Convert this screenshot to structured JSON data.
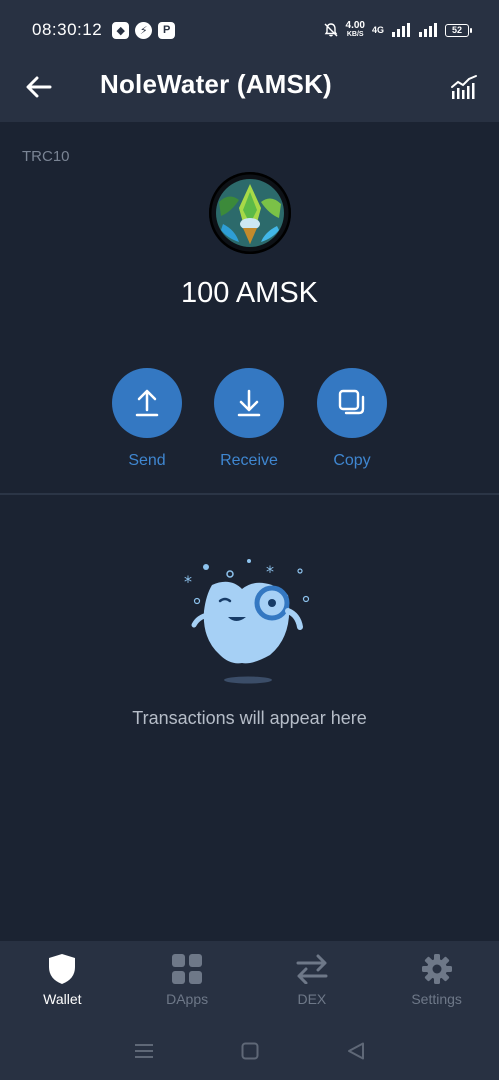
{
  "status_bar": {
    "time": "08:30:12",
    "net_speed_value": "4.00",
    "net_speed_unit": "KB/S",
    "network_type": "4G",
    "battery": "52"
  },
  "header": {
    "title": "NoleWater (AMSK)"
  },
  "token": {
    "type": "TRC10",
    "balance": "100 AMSK"
  },
  "actions": {
    "send": "Send",
    "receive": "Receive",
    "copy": "Copy"
  },
  "empty_state": {
    "message": "Transactions will appear here"
  },
  "bottom_nav": {
    "items": [
      {
        "label": "Wallet",
        "icon": "shield-icon",
        "active": true
      },
      {
        "label": "DApps",
        "icon": "grid-icon",
        "active": false
      },
      {
        "label": "DEX",
        "icon": "swap-arrows-icon",
        "active": false
      },
      {
        "label": "Settings",
        "icon": "gear-icon",
        "active": false
      }
    ]
  },
  "colors": {
    "background": "#1b2332",
    "bar": "#283142",
    "accent": "#3478c2",
    "accent_text": "#3f86d0"
  }
}
